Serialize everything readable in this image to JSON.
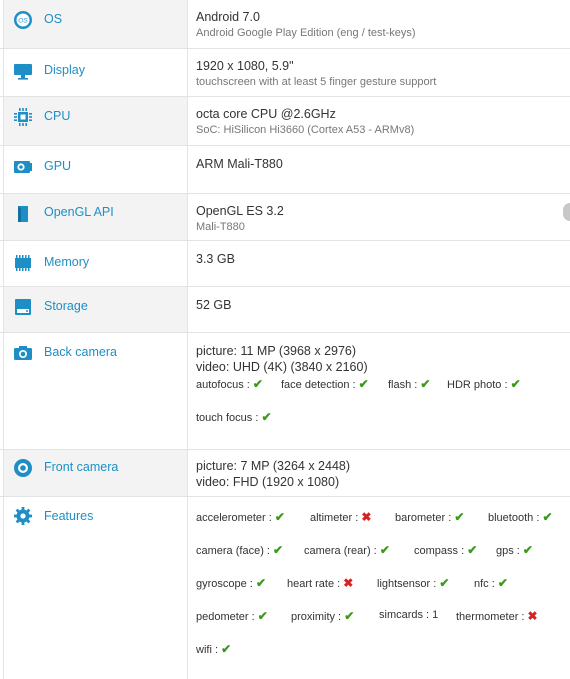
{
  "colors": {
    "accent": "#1e8fc6",
    "check": "#3a9a1b",
    "cross": "#d32424"
  },
  "os": {
    "icon": "os-icon",
    "label": "OS",
    "main": "Android 7.0",
    "sub": "Android Google Play Edition (eng / test-keys)"
  },
  "display": {
    "icon": "display-icon",
    "label": "Display",
    "main": "1920 x 1080, 5.9\"",
    "sub": "touchscreen with at least 5 finger gesture support"
  },
  "cpu": {
    "icon": "cpu-icon",
    "label": "CPU",
    "main": "octa core CPU @2.6GHz",
    "sub": "SoC: HiSilicon Hi3660 (Cortex A53 - ARMv8)"
  },
  "gpu": {
    "icon": "gpu-icon",
    "label": "GPU",
    "main": "ARM Mali-T880"
  },
  "opengl": {
    "icon": "opengl-icon",
    "label": "OpenGL API",
    "main": "OpenGL ES 3.2",
    "sub": "Mali-T880"
  },
  "memory": {
    "icon": "memory-icon",
    "label": "Memory",
    "main": "3.3 GB"
  },
  "storage": {
    "icon": "storage-icon",
    "label": "Storage",
    "main": "52 GB"
  },
  "back_camera": {
    "icon": "camera-icon",
    "label": "Back camera",
    "picture": "picture: 11 MP (3968 x 2976)",
    "video": "video: UHD (4K) (3840 x 2160)",
    "features": [
      {
        "label": "autofocus :",
        "ok": true
      },
      {
        "label": "face detection :",
        "ok": true
      },
      {
        "label": "flash :",
        "ok": true
      },
      {
        "label": "HDR photo :",
        "ok": true
      },
      {
        "label": "touch focus :",
        "ok": true
      }
    ]
  },
  "front_camera": {
    "icon": "front-camera-icon",
    "label": "Front camera",
    "picture": "picture: 7 MP (3264 x 2448)",
    "video": "video: FHD (1920 x 1080)"
  },
  "features": {
    "icon": "gear-icon",
    "label": "Features",
    "items": [
      {
        "label": "accelerometer :",
        "mark": "check"
      },
      {
        "label": "altimeter :",
        "mark": "cross"
      },
      {
        "label": "barometer :",
        "mark": "check"
      },
      {
        "label": "bluetooth :",
        "mark": "check"
      },
      {
        "label": "camera (face) :",
        "mark": "check"
      },
      {
        "label": "camera (rear) :",
        "mark": "check"
      },
      {
        "label": "compass :",
        "mark": "check"
      },
      {
        "label": "gps :",
        "mark": "check"
      },
      {
        "label": "gyroscope :",
        "mark": "check"
      },
      {
        "label": "heart rate :",
        "mark": "cross"
      },
      {
        "label": "lightsensor :",
        "mark": "check"
      },
      {
        "label": "nfc :",
        "mark": "check"
      },
      {
        "label": "pedometer :",
        "mark": "check"
      },
      {
        "label": "proximity :",
        "mark": "check"
      },
      {
        "label": "simcards : 1",
        "mark": "none"
      },
      {
        "label": "thermometer :",
        "mark": "cross"
      },
      {
        "label": "wifi :",
        "mark": "check"
      }
    ]
  },
  "marks": {
    "check": "✔",
    "cross": "✖"
  }
}
